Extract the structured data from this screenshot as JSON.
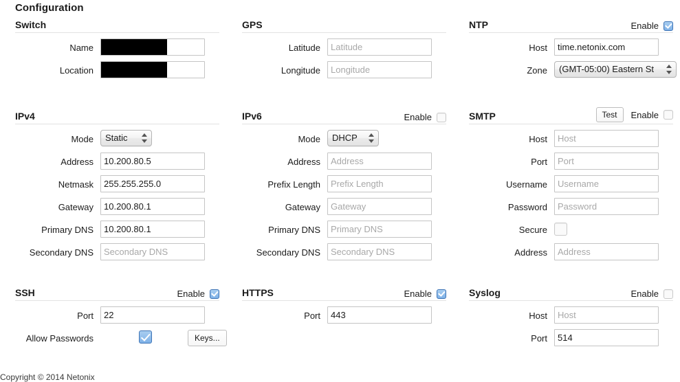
{
  "page": {
    "title": "Configuration",
    "footer": "Copyright © 2014 Netonix"
  },
  "common": {
    "enable_label": "Enable"
  },
  "sections": {
    "switch": {
      "title": "Switch",
      "fields": {
        "name": {
          "label": "Name",
          "value": "",
          "placeholder": "",
          "redacted": true
        },
        "location": {
          "label": "Location",
          "value": "",
          "placeholder": "",
          "redacted": true
        }
      }
    },
    "gps": {
      "title": "GPS",
      "fields": {
        "latitude": {
          "label": "Latitude",
          "value": "",
          "placeholder": "Latitude"
        },
        "longitude": {
          "label": "Longitude",
          "value": "",
          "placeholder": "Longitude"
        }
      }
    },
    "ntp": {
      "title": "NTP",
      "enabled": true,
      "fields": {
        "host": {
          "label": "Host",
          "value": "time.netonix.com",
          "placeholder": "Host"
        },
        "zone": {
          "label": "Zone",
          "value": "(GMT-05:00) Eastern St"
        }
      }
    },
    "ipv4": {
      "title": "IPv4",
      "fields": {
        "mode": {
          "label": "Mode",
          "value": "Static"
        },
        "address": {
          "label": "Address",
          "value": "10.200.80.5",
          "placeholder": "Address"
        },
        "netmask": {
          "label": "Netmask",
          "value": "255.255.255.0",
          "placeholder": "Netmask"
        },
        "gateway": {
          "label": "Gateway",
          "value": "10.200.80.1",
          "placeholder": "Gateway"
        },
        "primary_dns": {
          "label": "Primary DNS",
          "value": "10.200.80.1",
          "placeholder": "Primary DNS"
        },
        "secondary_dns": {
          "label": "Secondary DNS",
          "value": "",
          "placeholder": "Secondary DNS"
        }
      }
    },
    "ipv6": {
      "title": "IPv6",
      "enabled": false,
      "fields": {
        "mode": {
          "label": "Mode",
          "value": "DHCP"
        },
        "address": {
          "label": "Address",
          "value": "",
          "placeholder": "Address"
        },
        "prefix_length": {
          "label": "Prefix Length",
          "value": "",
          "placeholder": "Prefix Length"
        },
        "gateway": {
          "label": "Gateway",
          "value": "",
          "placeholder": "Gateway"
        },
        "primary_dns": {
          "label": "Primary DNS",
          "value": "",
          "placeholder": "Primary DNS"
        },
        "secondary_dns": {
          "label": "Secondary DNS",
          "value": "",
          "placeholder": "Secondary DNS"
        }
      }
    },
    "smtp": {
      "title": "SMTP",
      "enabled": false,
      "test_label": "Test",
      "fields": {
        "host": {
          "label": "Host",
          "value": "",
          "placeholder": "Host"
        },
        "port": {
          "label": "Port",
          "value": "",
          "placeholder": "Port"
        },
        "username": {
          "label": "Username",
          "value": "",
          "placeholder": "Username"
        },
        "password": {
          "label": "Password",
          "value": "",
          "placeholder": "Password"
        },
        "secure": {
          "label": "Secure",
          "checked": false
        },
        "address": {
          "label": "Address",
          "value": "",
          "placeholder": "Address"
        }
      }
    },
    "ssh": {
      "title": "SSH",
      "enabled": true,
      "keys_label": "Keys...",
      "fields": {
        "port": {
          "label": "Port",
          "value": "22",
          "placeholder": "Port"
        },
        "allow_passwords": {
          "label": "Allow Passwords",
          "checked": true
        }
      }
    },
    "https": {
      "title": "HTTPS",
      "enabled": true,
      "fields": {
        "port": {
          "label": "Port",
          "value": "443",
          "placeholder": "Port"
        }
      }
    },
    "syslog": {
      "title": "Syslog",
      "enabled": false,
      "fields": {
        "host": {
          "label": "Host",
          "value": "",
          "placeholder": "Host"
        },
        "port": {
          "label": "Port",
          "value": "514",
          "placeholder": "Port"
        }
      }
    }
  }
}
